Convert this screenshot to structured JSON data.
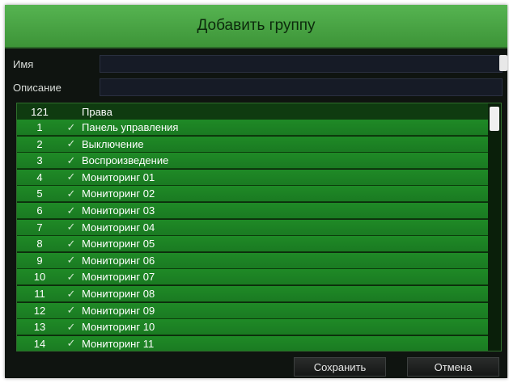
{
  "dialog": {
    "title": "Добавить группу",
    "name_label": "Имя",
    "name_value": "",
    "description_label": "Описание",
    "description_value": ""
  },
  "table": {
    "header": {
      "num": "121",
      "name": "Права"
    },
    "rows": [
      {
        "num": "1",
        "name": "Панель управления",
        "checked": true
      },
      {
        "num": "2",
        "name": "Выключение",
        "checked": true
      },
      {
        "num": "3",
        "name": "Воспроизведение",
        "checked": true
      },
      {
        "num": "4",
        "name": "Мониторинг 01",
        "checked": true
      },
      {
        "num": "5",
        "name": "Мониторинг 02",
        "checked": true
      },
      {
        "num": "6",
        "name": "Мониторинг 03",
        "checked": true
      },
      {
        "num": "7",
        "name": "Мониторинг 04",
        "checked": true
      },
      {
        "num": "8",
        "name": "Мониторинг 05",
        "checked": true
      },
      {
        "num": "9",
        "name": "Мониторинг 06",
        "checked": true
      },
      {
        "num": "10",
        "name": "Мониторинг 07",
        "checked": true
      },
      {
        "num": "11",
        "name": "Мониторинг 08",
        "checked": true
      },
      {
        "num": "12",
        "name": "Мониторинг 09",
        "checked": true
      },
      {
        "num": "13",
        "name": "Мониторинг 10",
        "checked": true
      },
      {
        "num": "14",
        "name": "Мониторинг 11",
        "checked": true
      }
    ]
  },
  "buttons": {
    "save": "Сохранить",
    "cancel": "Отмена"
  },
  "icons": {
    "check": "checkmark-icon"
  },
  "colors": {
    "title_bar": "#4aa645",
    "row_fill": "#1f8a26",
    "header_fill": "#0f3b10"
  }
}
